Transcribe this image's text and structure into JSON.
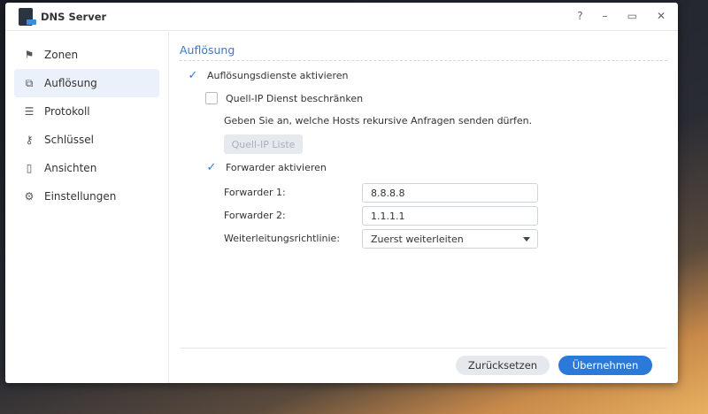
{
  "window": {
    "title": "DNS Server",
    "controls": [
      "?",
      "–",
      "▭",
      "✕"
    ]
  },
  "sidebar": {
    "items": [
      {
        "label": "Zonen",
        "icon": "flag-icon",
        "glyph": "⚑"
      },
      {
        "label": "Auflösung",
        "icon": "resolve-icon",
        "glyph": "⧉"
      },
      {
        "label": "Protokoll",
        "icon": "list-icon",
        "glyph": "☰"
      },
      {
        "label": "Schlüssel",
        "icon": "key-icon",
        "glyph": "⚷"
      },
      {
        "label": "Ansichten",
        "icon": "book-icon",
        "glyph": "▯"
      },
      {
        "label": "Einstellungen",
        "icon": "gear-icon",
        "glyph": "⚙"
      }
    ]
  },
  "main": {
    "section_title": "Auflösung",
    "enable_resolution": {
      "label": "Auflösungsdienste aktivieren",
      "checked": true
    },
    "restrict_source": {
      "label": "Quell-IP Dienst beschränken",
      "checked": false
    },
    "hint": "Geben Sie an, welche Hosts rekursive Anfragen senden dürfen.",
    "source_ip_list_button": "Quell-IP Liste",
    "enable_forwarder": {
      "label": "Forwarder aktivieren",
      "checked": true
    },
    "forwarder1": {
      "label": "Forwarder 1:",
      "value": "8.8.8.8"
    },
    "forwarder2": {
      "label": "Forwarder 2:",
      "value": "1.1.1.1"
    },
    "policy": {
      "label": "Weiterleitungsrichtlinie:",
      "value": "Zuerst weiterleiten"
    }
  },
  "footer": {
    "reset": "Zurücksetzen",
    "apply": "Übernehmen"
  },
  "check_glyph": "✓"
}
